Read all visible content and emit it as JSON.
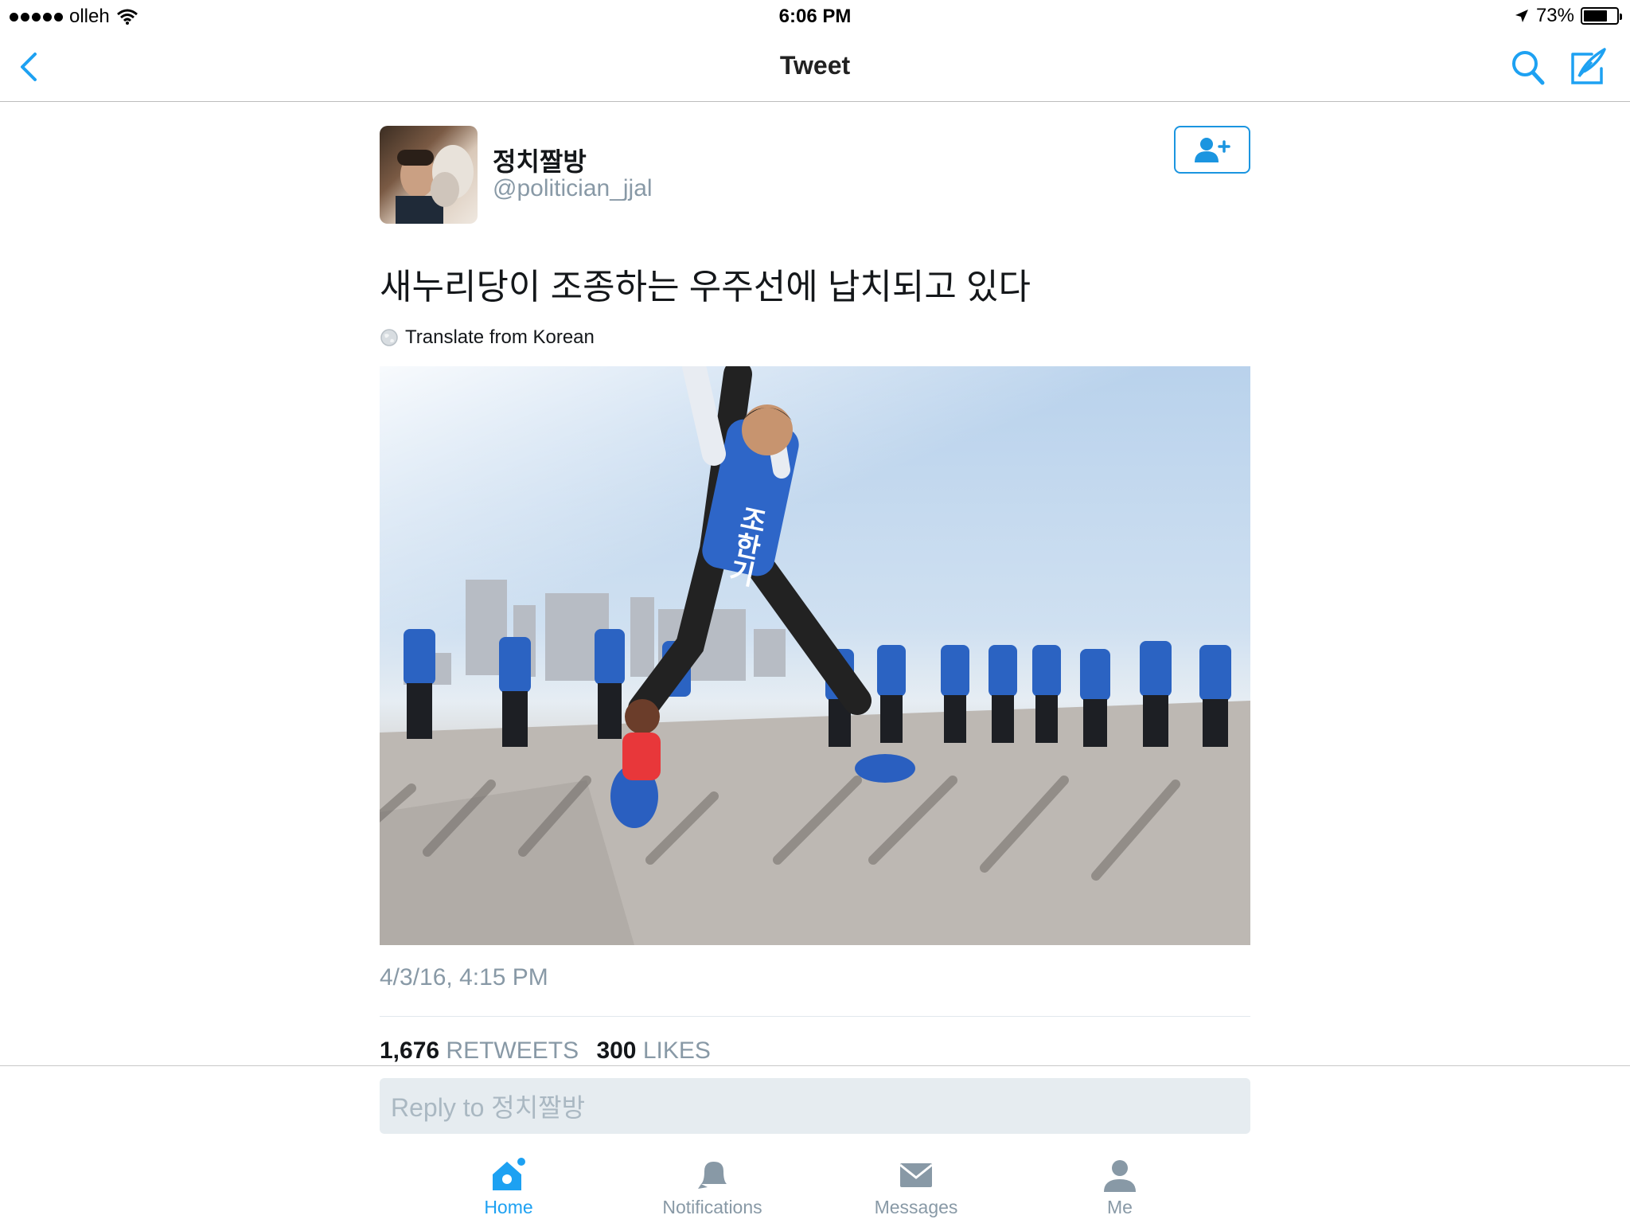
{
  "status_bar": {
    "carrier": "olleh",
    "time": "6:06 PM",
    "battery": "73%",
    "battery_level": 0.73
  },
  "nav": {
    "title": "Tweet"
  },
  "tweet": {
    "display_name": "정치짤방",
    "handle": "@politician_jjal",
    "text": "새누리당이 조종하는 우주선에 납치되고 있다",
    "translate_label": "Translate from Korean",
    "date": "4/3/16, 4:15 PM",
    "retweets_count": "1,676",
    "retweets_label": "RETWEETS",
    "likes_count": "300",
    "likes_label": "LIKES",
    "photo_jacket_text": "조한기"
  },
  "reply": {
    "placeholder": "Reply to 정치짤방"
  },
  "tabs": [
    {
      "label": "Home",
      "icon": "home-icon",
      "active": true
    },
    {
      "label": "Notifications",
      "icon": "bell-icon",
      "active": false
    },
    {
      "label": "Messages",
      "icon": "envelope-icon",
      "active": false
    },
    {
      "label": "Me",
      "icon": "person-icon",
      "active": false
    }
  ],
  "colors": {
    "accent": "#1da1f2",
    "secondary_text": "#8899a6"
  }
}
